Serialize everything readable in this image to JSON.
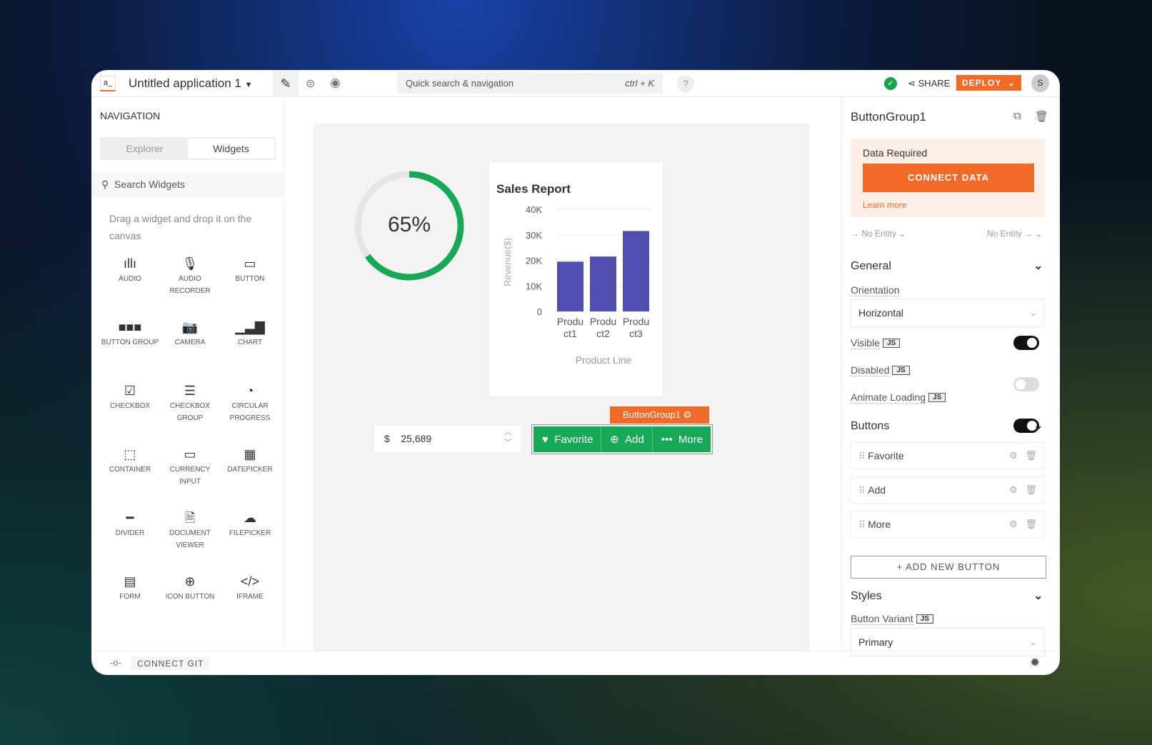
{
  "header": {
    "app_icon": "a_",
    "title": "Untitled application 1",
    "search_placeholder": "Quick search & navigation",
    "search_shortcut": "ctrl + K",
    "help": "?",
    "share": "SHARE",
    "deploy": "DEPLOY",
    "avatar": "S",
    "status_color": "#16a34a",
    "accent": "#f26a27"
  },
  "sidebar": {
    "title": "NAVIGATION",
    "tabs": [
      "Explorer",
      "Widgets"
    ],
    "active_tab": "Widgets",
    "search_placeholder": "Search Widgets",
    "hint": "Drag a widget and drop it on the canvas",
    "widgets": [
      {
        "label": "AUDIO",
        "icon": "audio-icon",
        "glyph": "ıllı"
      },
      {
        "label": "AUDIO RECORDER",
        "icon": "microphone-icon",
        "glyph": "🎙"
      },
      {
        "label": "BUTTON",
        "icon": "button-icon",
        "glyph": "▭"
      },
      {
        "label": "BUTTON GROUP",
        "icon": "button-group-icon",
        "glyph": "■■■"
      },
      {
        "label": "CAMERA",
        "icon": "camera-icon",
        "glyph": "📷"
      },
      {
        "label": "CHART",
        "icon": "chart-icon",
        "glyph": "▁▃▇"
      },
      {
        "label": "CHECKBOX",
        "icon": "checkbox-icon",
        "glyph": "☑"
      },
      {
        "label": "CHECKBOX GROUP",
        "icon": "checkbox-group-icon",
        "glyph": "☰"
      },
      {
        "label": "CIRCULAR PROGRESS",
        "icon": "circular-progress-icon",
        "glyph": "◔"
      },
      {
        "label": "CONTAINER",
        "icon": "container-icon",
        "glyph": "⬚"
      },
      {
        "label": "CURRENCY INPUT",
        "icon": "currency-input-icon",
        "glyph": "▭"
      },
      {
        "label": "DATEPICKER",
        "icon": "calendar-icon",
        "glyph": "▦"
      },
      {
        "label": "DIVIDER",
        "icon": "divider-icon",
        "glyph": "━"
      },
      {
        "label": "DOCUMENT VIEWER",
        "icon": "pdf-icon",
        "glyph": "🗎"
      },
      {
        "label": "FILEPICKER",
        "icon": "cloud-upload-icon",
        "glyph": "☁"
      },
      {
        "label": "FORM",
        "icon": "form-icon",
        "glyph": "▤"
      },
      {
        "label": "ICON BUTTON",
        "icon": "plus-circle-icon",
        "glyph": "⊕"
      },
      {
        "label": "IFRAME",
        "icon": "code-icon",
        "glyph": "</>"
      }
    ]
  },
  "footer": {
    "connect_git": "CONNECT GIT"
  },
  "canvas": {
    "progress": {
      "value": 65,
      "label": "65%",
      "color": "#18a957"
    },
    "currency": {
      "symbol": "$",
      "value": "25,689"
    },
    "button_group": {
      "label": "ButtonGroup1",
      "buttons": [
        "Favorite",
        "Add",
        "More"
      ],
      "color": "#18a957"
    }
  },
  "chart_data": {
    "type": "bar",
    "title": "Sales Report",
    "xlabel": "Product Line",
    "ylabel": "Revenue($)",
    "categories": [
      "Product1",
      "Product2",
      "Product3"
    ],
    "category_labels": [
      [
        "Produ",
        "ct1"
      ],
      [
        "Produ",
        "ct2"
      ],
      [
        "Produ",
        "ct3"
      ]
    ],
    "values": [
      19500,
      21500,
      31500
    ],
    "ylim": [
      0,
      40000
    ],
    "yticks": [
      "40K",
      "30K",
      "20K",
      "10K",
      "0"
    ],
    "color": "#4f4fb0",
    "grid": true
  },
  "panel": {
    "title": "ButtonGroup1",
    "data_required": "Data Required",
    "connect_data": "CONNECT DATA",
    "learn_more": "Learn more",
    "entity_in": "→ No Entity ⌄",
    "entity_out": "No Entity → ⌄",
    "general": "General",
    "orientation_label": "Orientation",
    "orientation": "Horizontal",
    "visible": "Visible",
    "disabled": "Disabled",
    "animate_loading": "Animate Loading",
    "js": "JS",
    "toggles": {
      "visible": true,
      "disabled": false,
      "animate_loading": true
    },
    "buttons_section": "Buttons",
    "buttons": [
      "Favorite",
      "Add",
      "More"
    ],
    "add_new": "+ ADD NEW BUTTON",
    "styles": "Styles",
    "variant_label": "Button Variant",
    "variant": "Primary"
  }
}
